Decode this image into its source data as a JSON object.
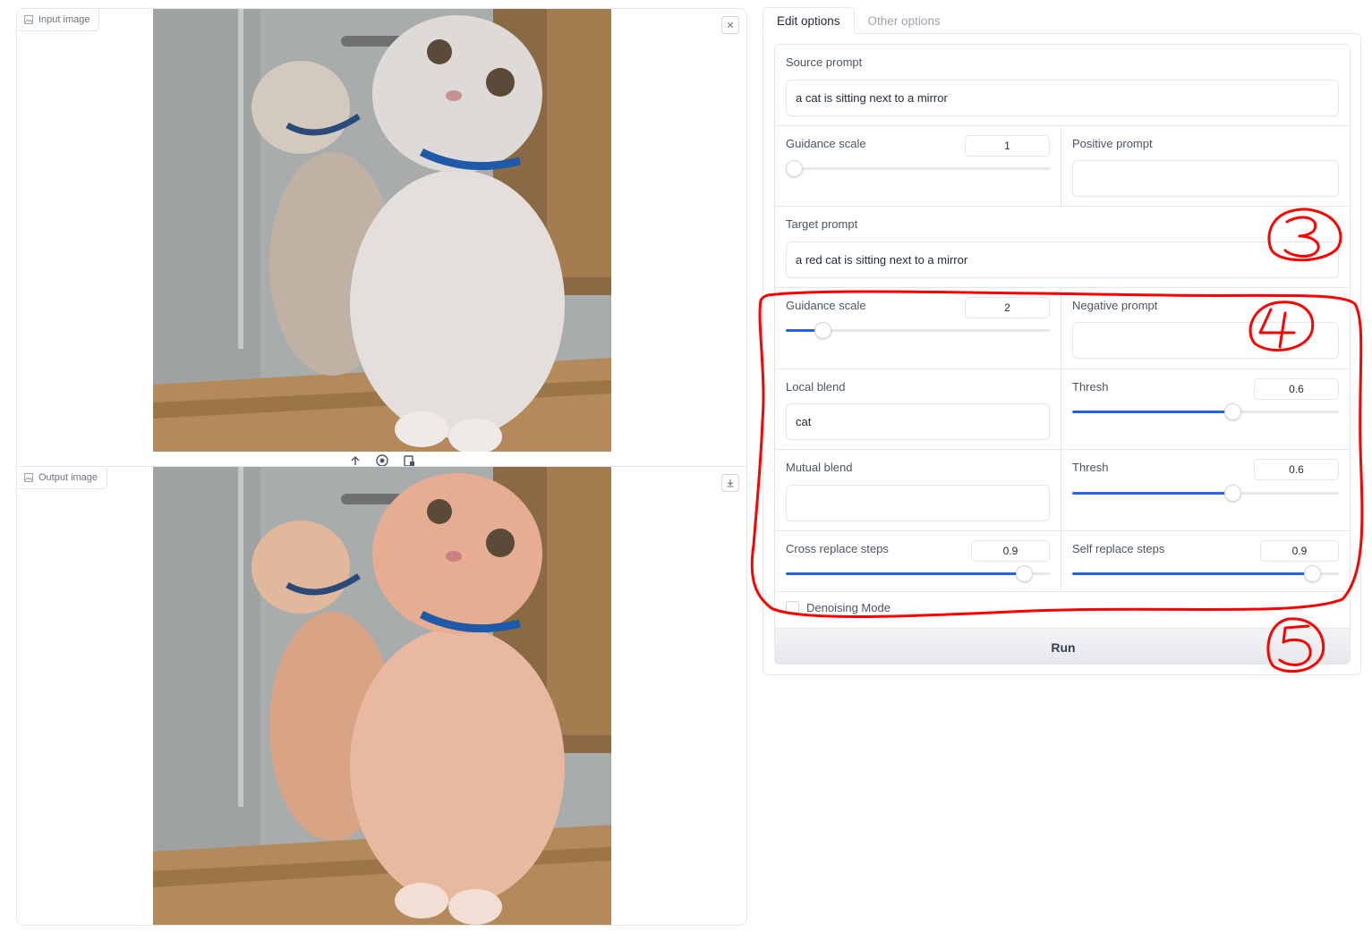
{
  "input_panel": {
    "label": "Input image",
    "close_icon": "close-icon",
    "source_icons": [
      "upload-icon",
      "webcam-icon",
      "clipboard-icon"
    ]
  },
  "output_panel": {
    "label": "Output image",
    "download_icon": "download-icon"
  },
  "tabs": [
    {
      "label": "Edit options",
      "active": true
    },
    {
      "label": "Other options",
      "active": false
    }
  ],
  "form": {
    "source_prompt": {
      "label": "Source prompt",
      "value": "a cat is sitting next to a mirror"
    },
    "source_guidance": {
      "label": "Guidance scale",
      "value": "1",
      "fraction": 0.0
    },
    "positive_prompt": {
      "label": "Positive prompt",
      "value": ""
    },
    "target_prompt": {
      "label": "Target prompt",
      "value": "a red cat is sitting next to a mirror"
    },
    "target_guidance": {
      "label": "Guidance scale",
      "value": "2",
      "fraction": 0.14
    },
    "negative_prompt": {
      "label": "Negative prompt",
      "value": ""
    },
    "local_blend": {
      "label": "Local blend",
      "value": "cat"
    },
    "local_thresh": {
      "label": "Thresh",
      "value": "0.6",
      "fraction": 0.6
    },
    "mutual_blend": {
      "label": "Mutual blend",
      "value": ""
    },
    "mutual_thresh": {
      "label": "Thresh",
      "value": "0.6",
      "fraction": 0.6
    },
    "cross_replace": {
      "label": "Cross replace steps",
      "value": "0.9",
      "fraction": 0.9
    },
    "self_replace": {
      "label": "Self replace steps",
      "value": "0.9",
      "fraction": 0.9
    },
    "denoising": {
      "label": "Denoising Mode",
      "checked": false
    },
    "run_label": "Run"
  },
  "annotations": {
    "color": "#ff0000",
    "marks": [
      "3",
      "4",
      "5"
    ]
  },
  "colors": {
    "accent": "#2563eb",
    "border": "#e5e7eb"
  }
}
